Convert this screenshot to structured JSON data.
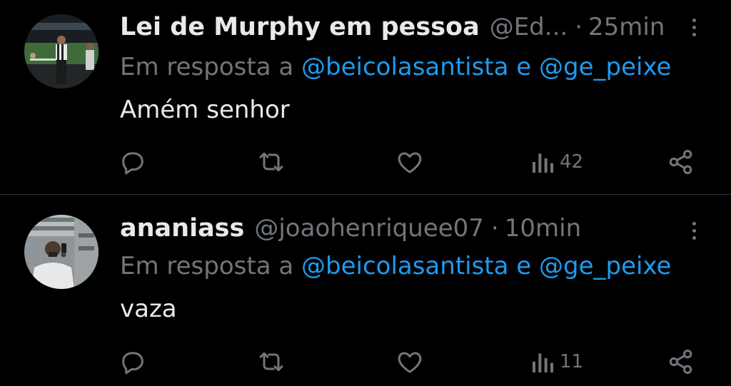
{
  "tweets": [
    {
      "name": "Lei de Murphy em pessoa",
      "handle": "@Ed...",
      "time": "25min",
      "reply_prefix": "Em resposta a",
      "mention1": "@beicolasantista",
      "conjunction": "e",
      "mention2": "@ge_peixe",
      "text": "Amém senhor",
      "views": "42",
      "avatar": "stadium-photo-avatar"
    },
    {
      "name": "ananiass",
      "handle": "@joaohenriquee07",
      "time": "10min",
      "reply_prefix": "Em resposta a",
      "mention1": "@beicolasantista",
      "conjunction": "e",
      "mention2": "@ge_peixe",
      "text": "vaza",
      "views": "11",
      "avatar": "mirror-selfie-avatar"
    }
  ],
  "separator": "·",
  "colors": {
    "background": "#000000",
    "text": "#e7e9ea",
    "muted": "#71767b",
    "link": "#1d9bf0",
    "divider": "#2f3336"
  },
  "icons": [
    "reply-icon",
    "retweet-icon",
    "like-icon",
    "views-icon",
    "share-icon",
    "more-options-icon"
  ]
}
